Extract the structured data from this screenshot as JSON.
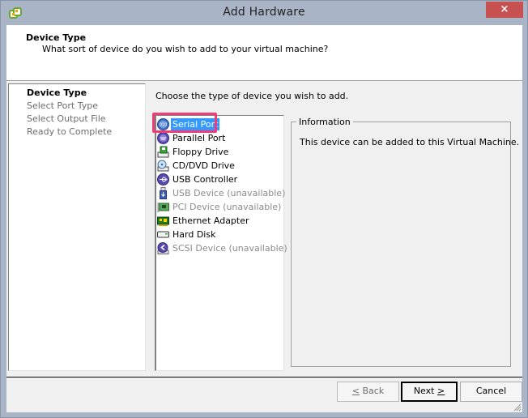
{
  "window": {
    "title": "Add Hardware",
    "app_icon": "vsphere-client-icon",
    "close_label": "×"
  },
  "header": {
    "title": "Device Type",
    "subtitle": "What sort of device do you wish to add to your virtual machine?"
  },
  "steps": [
    {
      "label": "Device Type",
      "active": true
    },
    {
      "label": "Select Port Type",
      "active": false
    },
    {
      "label": "Select Output File",
      "active": false
    },
    {
      "label": "Ready to Complete",
      "active": false
    }
  ],
  "main": {
    "prompt": "Choose the type of device you wish to add.",
    "devices": [
      {
        "label": "Serial Port",
        "icon": "serial-port-icon",
        "available": true,
        "selected": true
      },
      {
        "label": "Parallel Port",
        "icon": "parallel-port-icon",
        "available": true,
        "selected": false
      },
      {
        "label": "Floppy Drive",
        "icon": "floppy-drive-icon",
        "available": true,
        "selected": false
      },
      {
        "label": "CD/DVD Drive",
        "icon": "cd-dvd-drive-icon",
        "available": true,
        "selected": false
      },
      {
        "label": "USB Controller",
        "icon": "usb-controller-icon",
        "available": true,
        "selected": false
      },
      {
        "label": "USB Device (unavailable)",
        "icon": "usb-device-icon",
        "available": false,
        "selected": false
      },
      {
        "label": "PCI Device (unavailable)",
        "icon": "pci-device-icon",
        "available": false,
        "selected": false
      },
      {
        "label": "Ethernet Adapter",
        "icon": "ethernet-adapter-icon",
        "available": true,
        "selected": false
      },
      {
        "label": "Hard Disk",
        "icon": "hard-disk-icon",
        "available": true,
        "selected": false
      },
      {
        "label": "SCSI Device (unavailable)",
        "icon": "scsi-device-icon",
        "available": false,
        "selected": false
      }
    ],
    "information": {
      "legend": "Information",
      "text": "This device can be added to this Virtual Machine."
    }
  },
  "buttons": {
    "back": {
      "prefix": "",
      "mnemonic": "<",
      "text": " Back",
      "enabled": false
    },
    "next": {
      "text": "Next ",
      "mnemonic": ">",
      "enabled": true
    },
    "cancel": {
      "text": "Cancel",
      "enabled": true
    }
  },
  "colors": {
    "selection": "#3399ff",
    "highlight_annotation": "#ee3d78",
    "close_button": "#c75050",
    "frame": "#a9b5c6"
  }
}
